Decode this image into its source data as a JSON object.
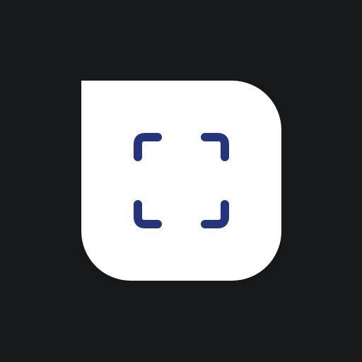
{
  "app_icon": {
    "icon_name": "scan-frame-icon",
    "background_color": "#17181a",
    "tile_color": "#ffffff",
    "glyph_color": "#24357e"
  }
}
